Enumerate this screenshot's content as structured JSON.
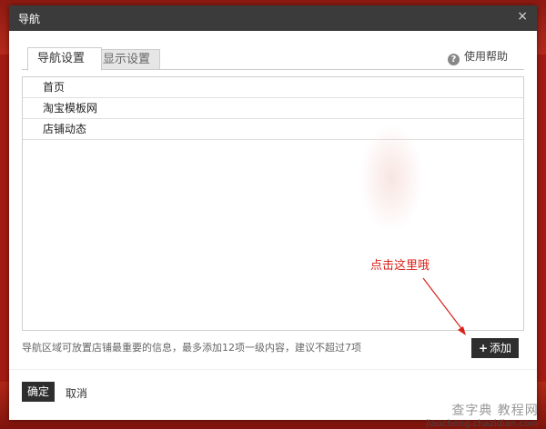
{
  "window": {
    "title": "导航",
    "close_icon": "×"
  },
  "tabs": [
    {
      "label": "导航设置",
      "active": true
    },
    {
      "label": "显示设置",
      "active": false
    }
  ],
  "help": {
    "icon": "?",
    "label": "使用帮助"
  },
  "nav_items": [
    {
      "label": "首页"
    },
    {
      "label": "淘宝模板网"
    },
    {
      "label": "店铺动态"
    }
  ],
  "annotation": {
    "text": "点击这里哦",
    "color": "#d8221a"
  },
  "hint": "导航区域可放置店铺最重要的信息，最多添加12项一级内容，建议不超过7项",
  "add_button": {
    "icon": "+",
    "label": "添加"
  },
  "footer": {
    "ok_label": "确定",
    "cancel_label": "取消"
  },
  "watermark": {
    "logo": "查字典 教程网",
    "url": "jiaocheng.chazidian.com"
  },
  "colors": {
    "titlebar": "#3b3b3b",
    "dark_button": "#2e2e2e",
    "backdrop": "#a31b12"
  }
}
